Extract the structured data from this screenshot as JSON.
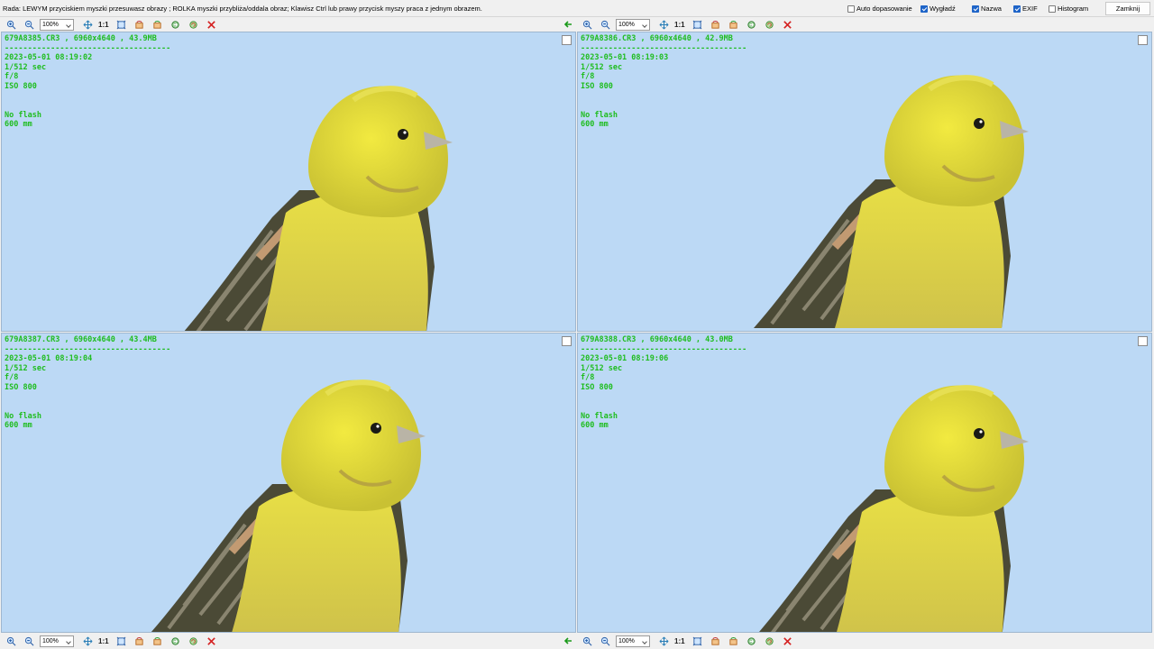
{
  "topbar": {
    "hint": "Rada: LEWYM przyciskiem myszki przesuwasz obrazy ; ROLKA myszki przybliża/oddala obraz; Klawisz Ctrl lub prawy przycisk myszy praca z jednym obrazem.",
    "options": [
      {
        "label": "Auto dopasowanie",
        "checked": false
      },
      {
        "label": "Wygładź",
        "checked": true
      },
      {
        "label": "Nazwa",
        "checked": true
      },
      {
        "label": "EXIF",
        "checked": true
      },
      {
        "label": "Histogram",
        "checked": false
      }
    ],
    "close_label": "Zamknij"
  },
  "toolbar": {
    "zoom": "100%",
    "one_to_one": "1:1"
  },
  "panes": [
    {
      "header": "679A8385.CR3 , 6960x4640 , 43.9MB",
      "separator": "------------------------------------",
      "date": "2023-05-01 08:19:02",
      "shutter": "1/512 sec",
      "aperture": "f/8",
      "iso": "ISO 800",
      "flash": "No flash",
      "focal": "600 mm"
    },
    {
      "header": "679A8386.CR3 , 6960x4640 , 42.9MB",
      "separator": "------------------------------------",
      "date": "2023-05-01 08:19:03",
      "shutter": "1/512 sec",
      "aperture": "f/8",
      "iso": "ISO 800",
      "flash": "No flash",
      "focal": "600 mm"
    },
    {
      "header": "679A8387.CR3 , 6960x4640 , 43.4MB",
      "separator": "------------------------------------",
      "date": "2023-05-01 08:19:04",
      "shutter": "1/512 sec",
      "aperture": "f/8",
      "iso": "ISO 800",
      "flash": "No flash",
      "focal": "600 mm"
    },
    {
      "header": "679A8388.CR3 , 6960x4640 , 43.0MB",
      "separator": "------------------------------------",
      "date": "2023-05-01 08:19:06",
      "shutter": "1/512 sec",
      "aperture": "f/8",
      "iso": "ISO 800",
      "flash": "No flash",
      "focal": "600 mm"
    }
  ],
  "colors": {
    "sky": "#bcd9f5",
    "exif_text": "#1fbd1f",
    "bird_yellow": "#e6dc3c",
    "close_x": "#d42020"
  },
  "icons": [
    "zoom-in-icon",
    "zoom-out-icon",
    "fit-arrows-icon",
    "fit-screen-icon",
    "rotate-left-icon",
    "rotate-right-icon",
    "flip-icon",
    "refresh-icon",
    "delete-x-icon",
    "arrow-left-icon"
  ]
}
